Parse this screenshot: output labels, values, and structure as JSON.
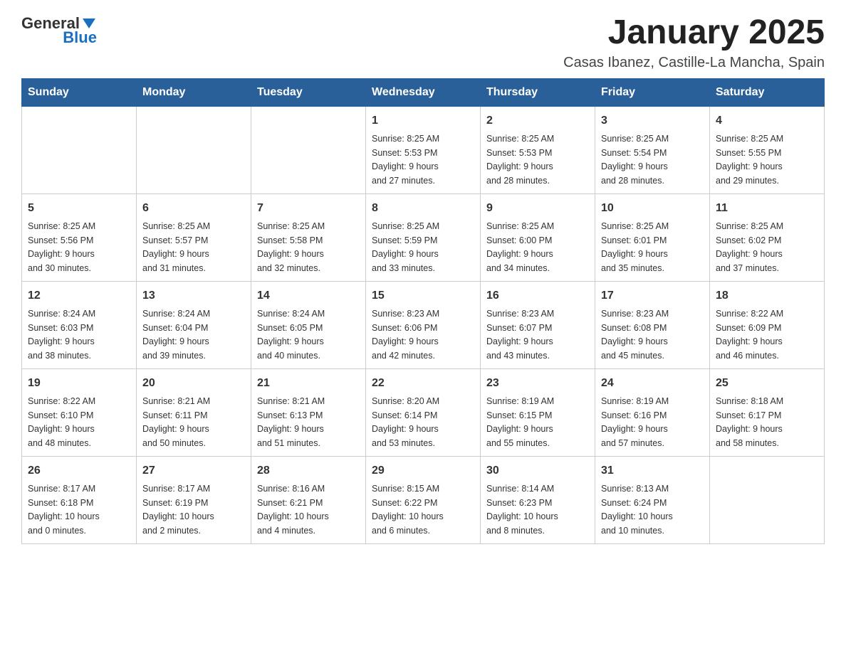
{
  "logo": {
    "general": "General",
    "blue": "Blue"
  },
  "header": {
    "title": "January 2025",
    "subtitle": "Casas Ibanez, Castille-La Mancha, Spain"
  },
  "weekdays": [
    "Sunday",
    "Monday",
    "Tuesday",
    "Wednesday",
    "Thursday",
    "Friday",
    "Saturday"
  ],
  "weeks": [
    [
      {
        "day": "",
        "info": ""
      },
      {
        "day": "",
        "info": ""
      },
      {
        "day": "",
        "info": ""
      },
      {
        "day": "1",
        "info": "Sunrise: 8:25 AM\nSunset: 5:53 PM\nDaylight: 9 hours\nand 27 minutes."
      },
      {
        "day": "2",
        "info": "Sunrise: 8:25 AM\nSunset: 5:53 PM\nDaylight: 9 hours\nand 28 minutes."
      },
      {
        "day": "3",
        "info": "Sunrise: 8:25 AM\nSunset: 5:54 PM\nDaylight: 9 hours\nand 28 minutes."
      },
      {
        "day": "4",
        "info": "Sunrise: 8:25 AM\nSunset: 5:55 PM\nDaylight: 9 hours\nand 29 minutes."
      }
    ],
    [
      {
        "day": "5",
        "info": "Sunrise: 8:25 AM\nSunset: 5:56 PM\nDaylight: 9 hours\nand 30 minutes."
      },
      {
        "day": "6",
        "info": "Sunrise: 8:25 AM\nSunset: 5:57 PM\nDaylight: 9 hours\nand 31 minutes."
      },
      {
        "day": "7",
        "info": "Sunrise: 8:25 AM\nSunset: 5:58 PM\nDaylight: 9 hours\nand 32 minutes."
      },
      {
        "day": "8",
        "info": "Sunrise: 8:25 AM\nSunset: 5:59 PM\nDaylight: 9 hours\nand 33 minutes."
      },
      {
        "day": "9",
        "info": "Sunrise: 8:25 AM\nSunset: 6:00 PM\nDaylight: 9 hours\nand 34 minutes."
      },
      {
        "day": "10",
        "info": "Sunrise: 8:25 AM\nSunset: 6:01 PM\nDaylight: 9 hours\nand 35 minutes."
      },
      {
        "day": "11",
        "info": "Sunrise: 8:25 AM\nSunset: 6:02 PM\nDaylight: 9 hours\nand 37 minutes."
      }
    ],
    [
      {
        "day": "12",
        "info": "Sunrise: 8:24 AM\nSunset: 6:03 PM\nDaylight: 9 hours\nand 38 minutes."
      },
      {
        "day": "13",
        "info": "Sunrise: 8:24 AM\nSunset: 6:04 PM\nDaylight: 9 hours\nand 39 minutes."
      },
      {
        "day": "14",
        "info": "Sunrise: 8:24 AM\nSunset: 6:05 PM\nDaylight: 9 hours\nand 40 minutes."
      },
      {
        "day": "15",
        "info": "Sunrise: 8:23 AM\nSunset: 6:06 PM\nDaylight: 9 hours\nand 42 minutes."
      },
      {
        "day": "16",
        "info": "Sunrise: 8:23 AM\nSunset: 6:07 PM\nDaylight: 9 hours\nand 43 minutes."
      },
      {
        "day": "17",
        "info": "Sunrise: 8:23 AM\nSunset: 6:08 PM\nDaylight: 9 hours\nand 45 minutes."
      },
      {
        "day": "18",
        "info": "Sunrise: 8:22 AM\nSunset: 6:09 PM\nDaylight: 9 hours\nand 46 minutes."
      }
    ],
    [
      {
        "day": "19",
        "info": "Sunrise: 8:22 AM\nSunset: 6:10 PM\nDaylight: 9 hours\nand 48 minutes."
      },
      {
        "day": "20",
        "info": "Sunrise: 8:21 AM\nSunset: 6:11 PM\nDaylight: 9 hours\nand 50 minutes."
      },
      {
        "day": "21",
        "info": "Sunrise: 8:21 AM\nSunset: 6:13 PM\nDaylight: 9 hours\nand 51 minutes."
      },
      {
        "day": "22",
        "info": "Sunrise: 8:20 AM\nSunset: 6:14 PM\nDaylight: 9 hours\nand 53 minutes."
      },
      {
        "day": "23",
        "info": "Sunrise: 8:19 AM\nSunset: 6:15 PM\nDaylight: 9 hours\nand 55 minutes."
      },
      {
        "day": "24",
        "info": "Sunrise: 8:19 AM\nSunset: 6:16 PM\nDaylight: 9 hours\nand 57 minutes."
      },
      {
        "day": "25",
        "info": "Sunrise: 8:18 AM\nSunset: 6:17 PM\nDaylight: 9 hours\nand 58 minutes."
      }
    ],
    [
      {
        "day": "26",
        "info": "Sunrise: 8:17 AM\nSunset: 6:18 PM\nDaylight: 10 hours\nand 0 minutes."
      },
      {
        "day": "27",
        "info": "Sunrise: 8:17 AM\nSunset: 6:19 PM\nDaylight: 10 hours\nand 2 minutes."
      },
      {
        "day": "28",
        "info": "Sunrise: 8:16 AM\nSunset: 6:21 PM\nDaylight: 10 hours\nand 4 minutes."
      },
      {
        "day": "29",
        "info": "Sunrise: 8:15 AM\nSunset: 6:22 PM\nDaylight: 10 hours\nand 6 minutes."
      },
      {
        "day": "30",
        "info": "Sunrise: 8:14 AM\nSunset: 6:23 PM\nDaylight: 10 hours\nand 8 minutes."
      },
      {
        "day": "31",
        "info": "Sunrise: 8:13 AM\nSunset: 6:24 PM\nDaylight: 10 hours\nand 10 minutes."
      },
      {
        "day": "",
        "info": ""
      }
    ]
  ]
}
